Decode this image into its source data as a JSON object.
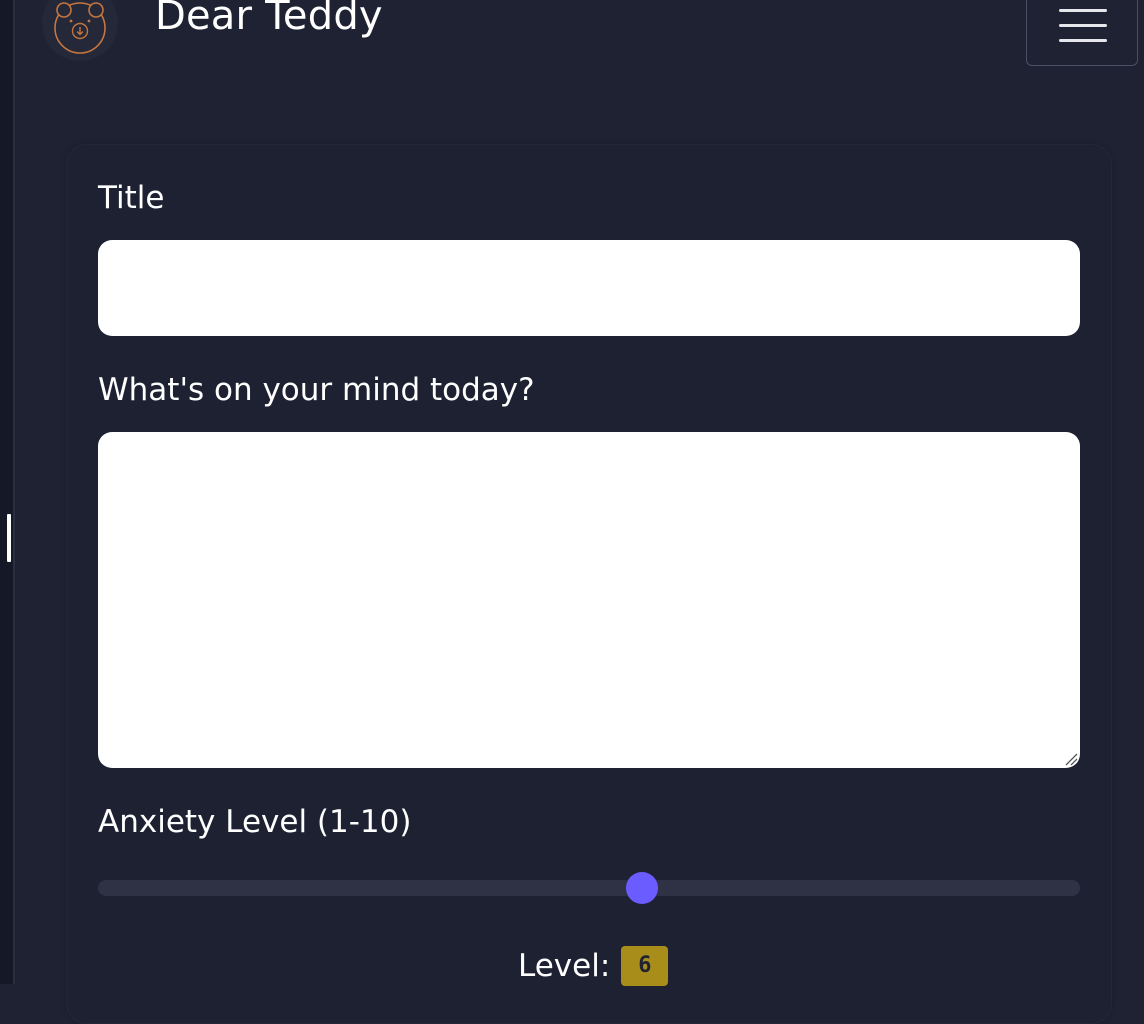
{
  "app": {
    "title": "Dear Teddy",
    "logo_icon": "teddy-bear-logo-icon",
    "menu_icon": "hamburger-menu-icon"
  },
  "form": {
    "title_label": "Title",
    "title_value": "",
    "mind_label": "What's on your mind today?",
    "mind_value": "",
    "anxiety_label": "Anxiety Level (1-10)",
    "anxiety": {
      "min": 1,
      "max": 10,
      "value": 6
    },
    "level_label": "Level:",
    "level_value": "6"
  },
  "colors": {
    "background": "#1f2233",
    "accent": "#6b5cff",
    "level_badge": "#a98d1a",
    "logo": "#c5763e"
  }
}
